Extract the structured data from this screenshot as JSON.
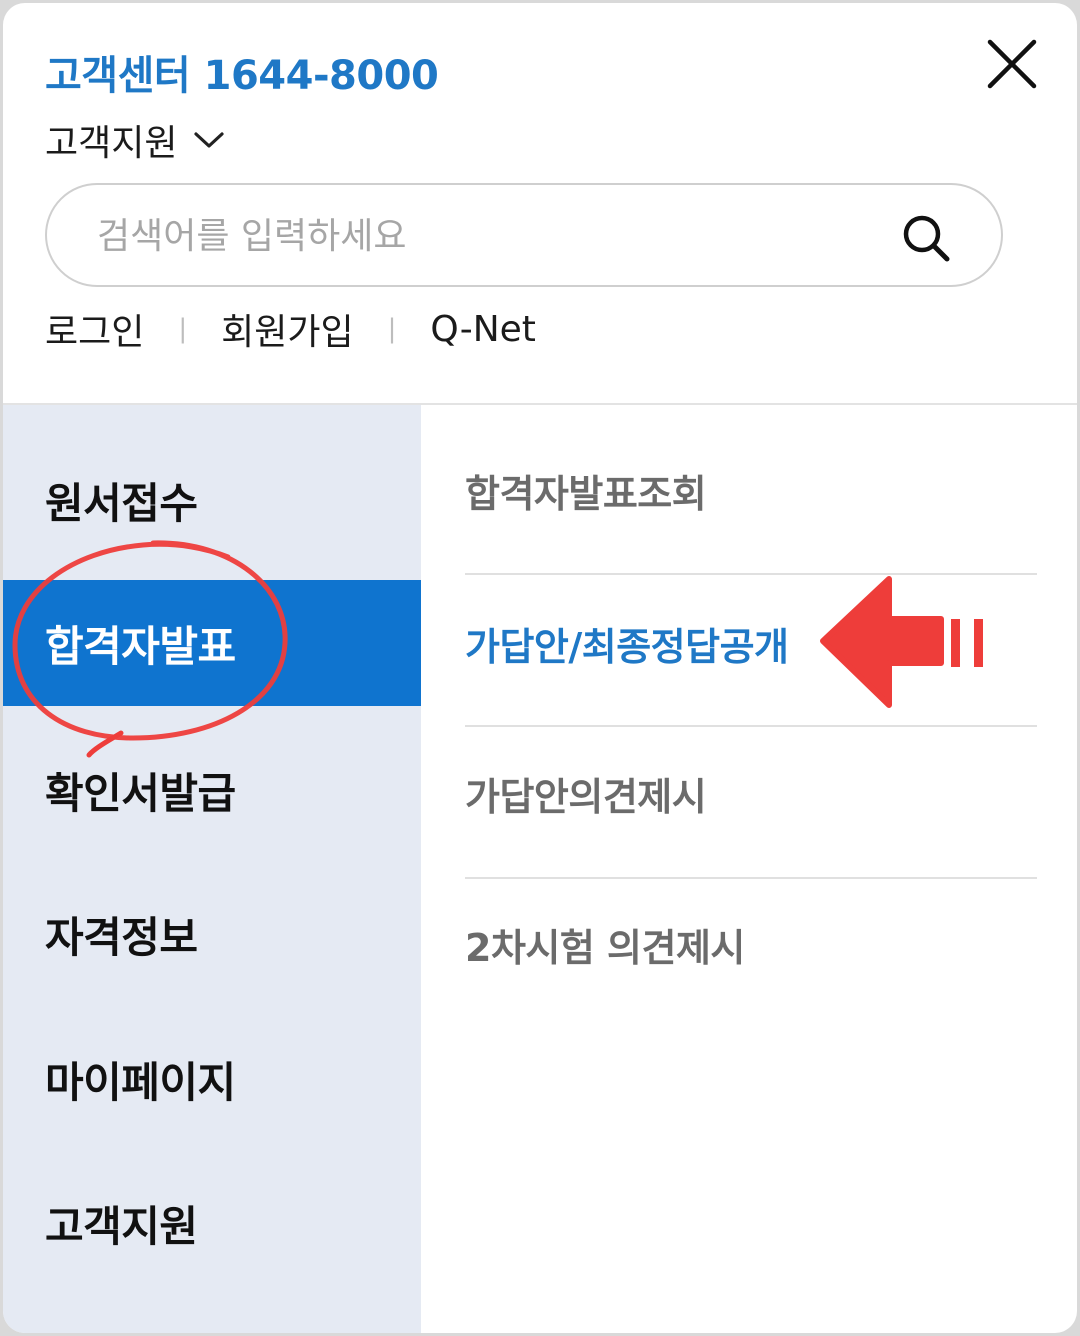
{
  "header": {
    "customer_center": "고객센터 1644-8000",
    "support_select": "고객지원",
    "search_placeholder": "검색어를 입력하세요",
    "links": [
      "로그인",
      "회원가입",
      "Q-Net"
    ],
    "separator": "|"
  },
  "sidebar": {
    "items": [
      "원서접수",
      "합격자발표",
      "확인서발급",
      "자격정보",
      "마이페이지",
      "고객지원"
    ],
    "active_index": 1
  },
  "submenu": {
    "items": [
      "합격자발표조회",
      "가답안/최종정답공개",
      "가답안의견제시",
      "2차시험 의견제시"
    ],
    "active_index": 1
  },
  "colors": {
    "brand_blue": "#1f78c6",
    "active_bg": "#0f74cf",
    "sidebar_bg": "#e5eaf3",
    "annotation_red": "#ee3d3a"
  },
  "icons": {
    "close": "close-icon",
    "chevron": "chevron-down-icon",
    "search": "search-icon"
  }
}
